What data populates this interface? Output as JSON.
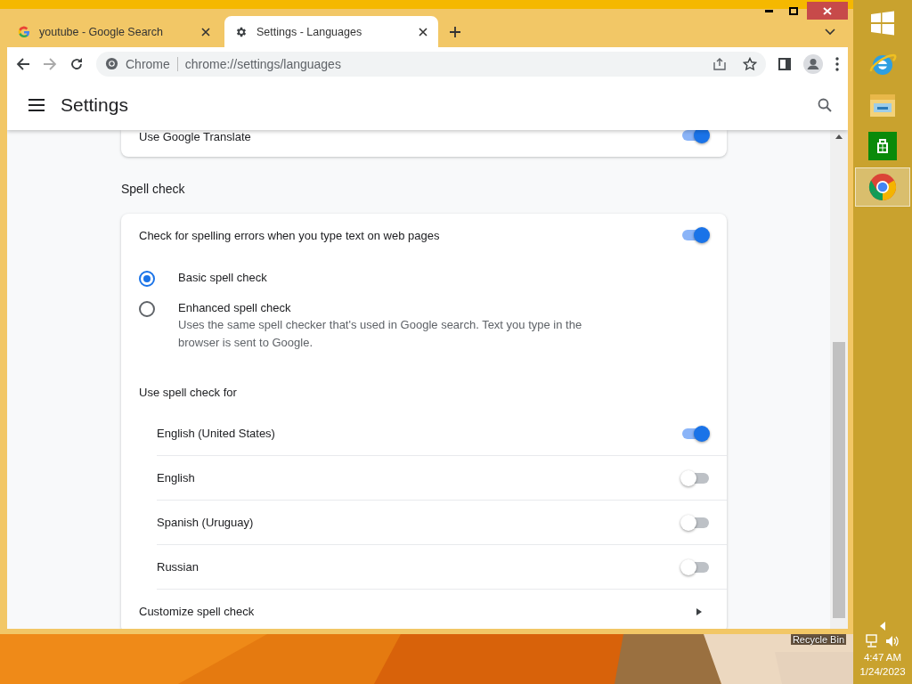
{
  "tabs": [
    {
      "label": "youtube - Google Search",
      "kind": "google",
      "selected": false
    },
    {
      "label": "Settings - Languages",
      "kind": "settings",
      "selected": true
    }
  ],
  "toolbar": {
    "site_label": "Chrome",
    "address": "chrome://settings/languages"
  },
  "header": {
    "title": "Settings"
  },
  "translate_row": {
    "label": "Use Google Translate",
    "on": true
  },
  "spell_check": {
    "heading": "Spell check",
    "toggle_row": {
      "label": "Check for spelling errors when you type text on web pages",
      "on": true
    },
    "options": [
      {
        "label": "Basic spell check",
        "selected": true
      },
      {
        "label": "Enhanced spell check",
        "selected": false,
        "description": "Uses the same spell checker that's used in Google search. Text you type in the browser is sent to Google."
      }
    ],
    "languages_heading": "Use spell check for",
    "languages": [
      {
        "label": "English (United States)",
        "on": true
      },
      {
        "label": "English",
        "on": false
      },
      {
        "label": "Spanish (Uruguay)",
        "on": false
      },
      {
        "label": "Russian",
        "on": false
      }
    ],
    "customize": "Customize spell check"
  },
  "desktop": {
    "icon_label": "Recycle Bin"
  },
  "taskbar": {
    "apps": [
      {
        "kind": "start",
        "selected": false
      },
      {
        "kind": "ie",
        "selected": false
      },
      {
        "kind": "explorer",
        "selected": false
      },
      {
        "kind": "store",
        "selected": false
      },
      {
        "kind": "chrome",
        "selected": true
      }
    ],
    "time": "4:47 AM",
    "date": "1/24/2023"
  }
}
